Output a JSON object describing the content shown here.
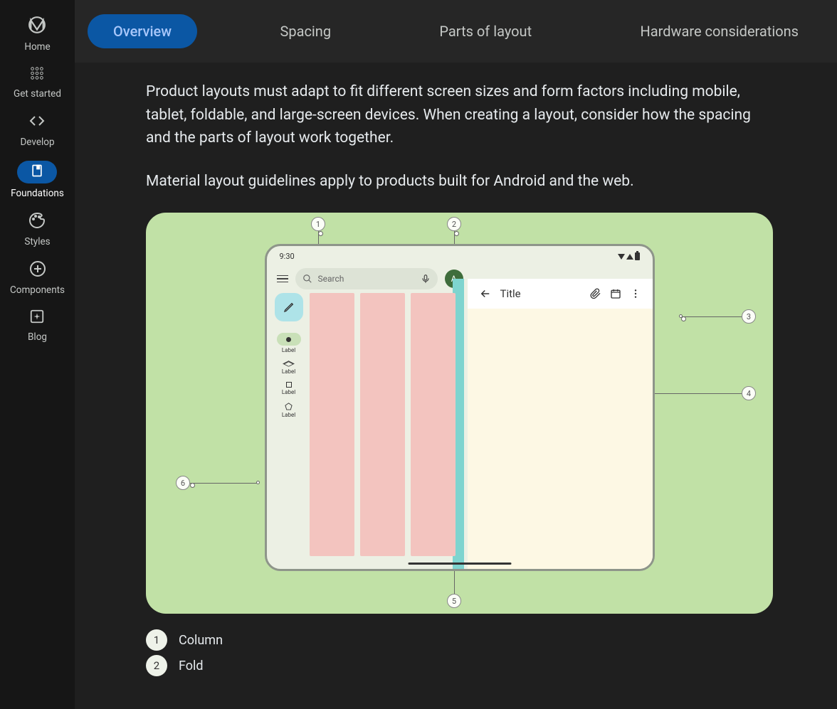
{
  "sidebar": {
    "items": [
      {
        "label": "Home",
        "icon": "material-logo"
      },
      {
        "label": "Get started",
        "icon": "apps"
      },
      {
        "label": "Develop",
        "icon": "code"
      },
      {
        "label": "Foundations",
        "icon": "book",
        "active": true
      },
      {
        "label": "Styles",
        "icon": "palette"
      },
      {
        "label": "Components",
        "icon": "add-circle"
      },
      {
        "label": "Blog",
        "icon": "sparkle"
      }
    ]
  },
  "tabs": {
    "items": [
      {
        "label": "Overview",
        "active": true
      },
      {
        "label": "Spacing"
      },
      {
        "label": "Parts of layout"
      },
      {
        "label": "Hardware considerations"
      }
    ]
  },
  "body": {
    "p1": "Product layouts must adapt to fit different screen sizes and form factors including mobile, tablet, foldable, and large-screen devices. When creating a layout, consider how the spacing and the parts of layout work together.",
    "p2": "Material layout guidelines apply to products built for Android and the web."
  },
  "device": {
    "time": "9:30",
    "search_placeholder": "Search",
    "avatar_initial": "A",
    "panel_title": "Title",
    "rail": [
      {
        "label": "Label",
        "icon": "circle",
        "active": true
      },
      {
        "label": "Label",
        "icon": "triangle"
      },
      {
        "label": "Label",
        "icon": "square"
      },
      {
        "label": "Label",
        "icon": "pentagon"
      }
    ]
  },
  "callouts": {
    "1": "1",
    "2": "2",
    "3": "3",
    "4": "4",
    "5": "5",
    "6": "6"
  },
  "legend": [
    {
      "num": "1",
      "label": "Column"
    },
    {
      "num": "2",
      "label": "Fold"
    }
  ]
}
